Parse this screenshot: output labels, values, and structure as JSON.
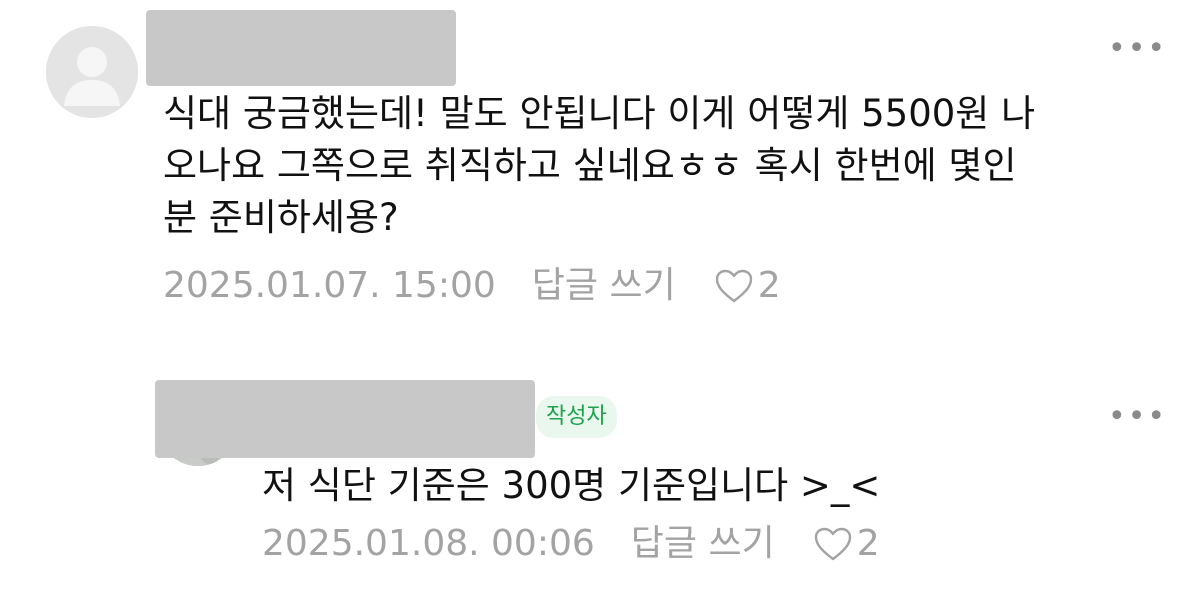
{
  "comments": [
    {
      "author_name": "",
      "body": "식대 궁금했는데! 말도 안됩니다 이게 어떻게 5500원 나\n오나요 그쪽으로 취직하고 싶네요ㅎㅎ 혹시 한번에 몇인\n분 준비하세용?",
      "timestamp": "2025.01.07. 15:00",
      "reply_label": "답글 쓰기",
      "like_count": "2",
      "more_label": "•••"
    },
    {
      "author_name": "",
      "author_badge": "작성자",
      "body": "저 식단 기준은 300명 기준입니다 >_<",
      "timestamp": "2025.01.08. 00:06",
      "reply_label": "답글 쓰기",
      "like_count": "2",
      "more_label": "•••"
    }
  ],
  "colors": {
    "text": "#111111",
    "meta": "#a3a3a3",
    "badge_text": "#1aa34a",
    "badge_bg": "#eaf7ee",
    "redaction": "#c8c8c8"
  }
}
